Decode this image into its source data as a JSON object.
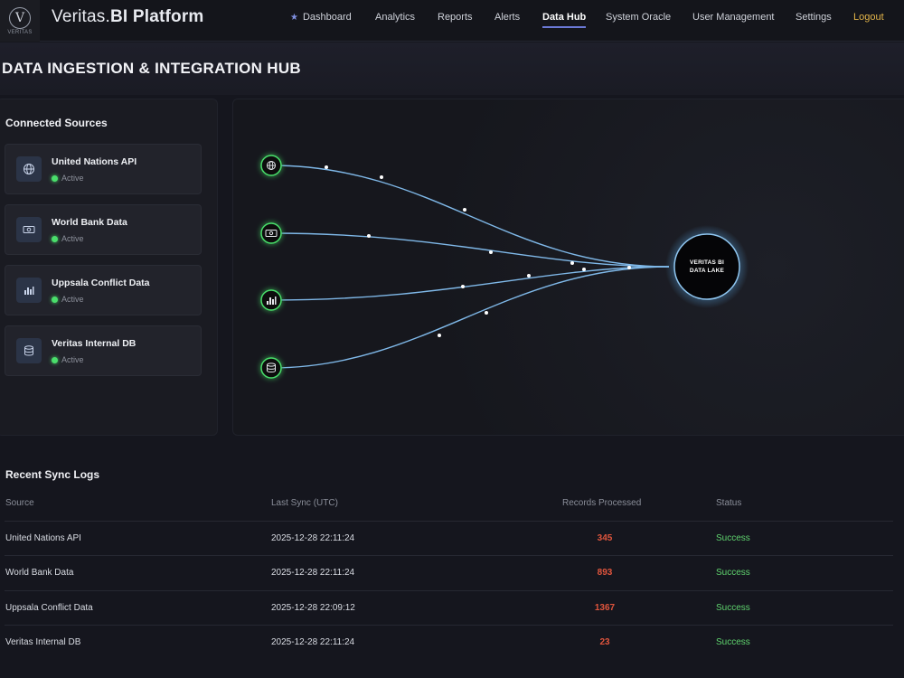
{
  "app": {
    "brand_regular": "Veritas.",
    "brand_bold": "BI Platform",
    "logo_letter": "V",
    "logo_sub": "VERITAS"
  },
  "nav": {
    "items": [
      "Dashboard",
      "Analytics",
      "Reports",
      "Alerts",
      "Data Hub",
      "System Oracle",
      "User Management",
      "Settings",
      "Logout"
    ],
    "active": "Data Hub"
  },
  "page": {
    "title": "DATA INGESTION & INTEGRATION HUB"
  },
  "sources": {
    "title": "Connected Sources",
    "items": [
      {
        "name": "United Nations API",
        "status": "Active",
        "icon": "globe-icon"
      },
      {
        "name": "World Bank Data",
        "status": "Active",
        "icon": "money-icon"
      },
      {
        "name": "Uppsala Conflict Data",
        "status": "Active",
        "icon": "bar-chart-icon"
      },
      {
        "name": "Veritas Internal DB",
        "status": "Active",
        "icon": "database-icon"
      }
    ]
  },
  "flow": {
    "target_line1": "VERITAS BI",
    "target_line2": "DATA LAKE",
    "line_color": "#7fb8e8",
    "node_glow": "#4ade6b"
  },
  "logs": {
    "title": "Recent Sync Logs",
    "headers": [
      "Source",
      "Last Sync (UTC)",
      "Records Processed",
      "Status"
    ],
    "rows": [
      {
        "source": "United Nations API",
        "time": "2025-12-28 22:11:24",
        "records": "345",
        "status": "Success"
      },
      {
        "source": "World Bank Data",
        "time": "2025-12-28 22:11:24",
        "records": "893",
        "status": "Success"
      },
      {
        "source": "Uppsala Conflict Data",
        "time": "2025-12-28 22:09:12",
        "records": "1367",
        "status": "Success"
      },
      {
        "source": "Veritas Internal DB",
        "time": "2025-12-28 22:11:24",
        "records": "23",
        "status": "Success"
      }
    ]
  },
  "colors": {
    "accent": "#6b79d6",
    "logout": "#e4b54a",
    "records": "#e0553d",
    "success": "#5fd36e"
  }
}
